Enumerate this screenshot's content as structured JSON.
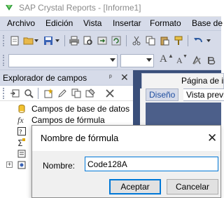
{
  "window": {
    "title": "SAP Crystal Reports - [Informe1]"
  },
  "menu": {
    "items": [
      "Archivo",
      "Edición",
      "Vista",
      "Insertar",
      "Formato",
      "Base de"
    ]
  },
  "toolbar": {
    "font_grow_label": "A",
    "font_shrink_label": "A",
    "icons": [
      "new-report-icon",
      "open-folder-icon",
      "save-icon",
      "print-icon",
      "cut-icon",
      "copy-icon",
      "paste-icon",
      "format-painter-icon"
    ]
  },
  "field_explorer": {
    "title": "Explorador de campos",
    "pin_glyph": "ᵖ",
    "close_glyph": "✕",
    "tree": [
      {
        "label": "Campos de base de datos",
        "icon": "database-icon"
      },
      {
        "label": "Campos de fórmula",
        "icon": "formula-icon"
      },
      {
        "label": "",
        "icon": "parameter-icon"
      },
      {
        "label": "",
        "icon": "running-total-icon"
      },
      {
        "label": "",
        "icon": "group-name-icon"
      },
      {
        "label": "",
        "icon": "special-fields-icon"
      }
    ]
  },
  "document": {
    "tab_label": "Página de ini",
    "subtabs": [
      "Diseño",
      "Vista previa"
    ]
  },
  "dialog": {
    "title": "Nombre de fórmula",
    "close_glyph": "✕",
    "name_label": "Nombre:",
    "name_value": "Code128A",
    "accept_label": "Aceptar",
    "cancel_label": "Cancelar"
  }
}
